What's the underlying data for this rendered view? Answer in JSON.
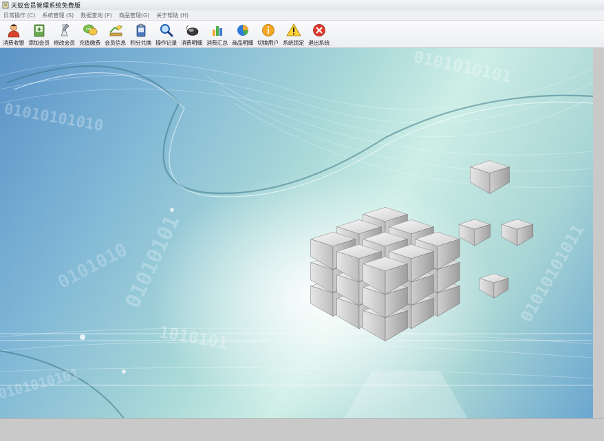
{
  "window": {
    "title": "天蚁会员管理系统免费版"
  },
  "menu": [
    {
      "label": "日常操作 (C)"
    },
    {
      "label": "系统管理 (S)"
    },
    {
      "label": "数据查询 (P)"
    },
    {
      "label": "商品管理(G)"
    },
    {
      "label": "关于帮助 (H)"
    }
  ],
  "toolbar": [
    {
      "label": "消费收银",
      "icon": "user-cashier-icon"
    },
    {
      "label": "添加会员",
      "icon": "add-member-icon"
    },
    {
      "label": "修改会员",
      "icon": "edit-member-icon"
    },
    {
      "label": "充值缴费",
      "icon": "recharge-icon"
    },
    {
      "label": "会员信息",
      "icon": "member-info-icon"
    },
    {
      "label": "积分兑换",
      "icon": "points-exchange-icon"
    },
    {
      "label": "操作记录",
      "icon": "search-log-icon"
    },
    {
      "label": "消费明细",
      "icon": "mouse-icon"
    },
    {
      "label": "消费汇总",
      "icon": "bar-chart-icon"
    },
    {
      "label": "商品明细",
      "icon": "pie-chart-icon"
    },
    {
      "label": "切换用户",
      "icon": "info-icon"
    },
    {
      "label": "系统锁定",
      "icon": "warning-icon"
    },
    {
      "label": "退出系统",
      "icon": "close-icon"
    }
  ],
  "background": {
    "binary_text": [
      "01010101010",
      "0101010",
      "01010101",
      "0101010101",
      "1010101",
      "01010101011",
      "0101010101"
    ]
  }
}
